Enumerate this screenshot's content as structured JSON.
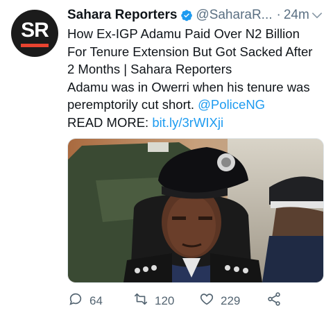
{
  "author": {
    "avatar_text": "SR",
    "name": "Sahara Reporters",
    "handle": "@SaharaR...",
    "separator": "·",
    "time": "24m"
  },
  "tweet": {
    "lines": [
      "How Ex-IGP Adamu Paid Over N2 Billion",
      "For Tenure Extension But Got Sacked After",
      "2 Months | Sahara Reporters",
      "Adamu was in Owerri when his tenure was",
      "peremptorily cut short. "
    ],
    "mention": "@PoliceNG",
    "read_more_label": "READ MORE: ",
    "link": "bit.ly/3rWIXji"
  },
  "actions": {
    "replies": "64",
    "retweets": "120",
    "likes": "229"
  },
  "colors": {
    "link": "#1d9bf0",
    "verified": "#1d9bf0",
    "avatar_bg": "#1b1b1b",
    "avatar_bar": "#e8432f",
    "muted": "#5b7083"
  },
  "icons": [
    "verified-badge-icon",
    "chevron-down-icon",
    "reply-icon",
    "retweet-icon",
    "like-icon",
    "share-icon"
  ]
}
